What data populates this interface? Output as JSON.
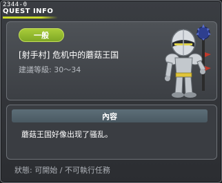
{
  "window": {
    "quest_id": "2344-0",
    "title": "QUEST INFO"
  },
  "quest": {
    "category": "一般",
    "name": "[射手村] 危机中的蘑菇王国",
    "level": "建議等級: 30～34"
  },
  "content": {
    "header": "內容",
    "text": "蘑菇王国好像出现了骚乱。"
  },
  "status": "狀態: 可開始 / 不可執行任務",
  "icons": {
    "quest_giver": "armored-knight-with-mace-icon"
  },
  "colors": {
    "accent": "#a9cc3a",
    "panel": "#3c3f44",
    "content_header": "#4a5962"
  }
}
